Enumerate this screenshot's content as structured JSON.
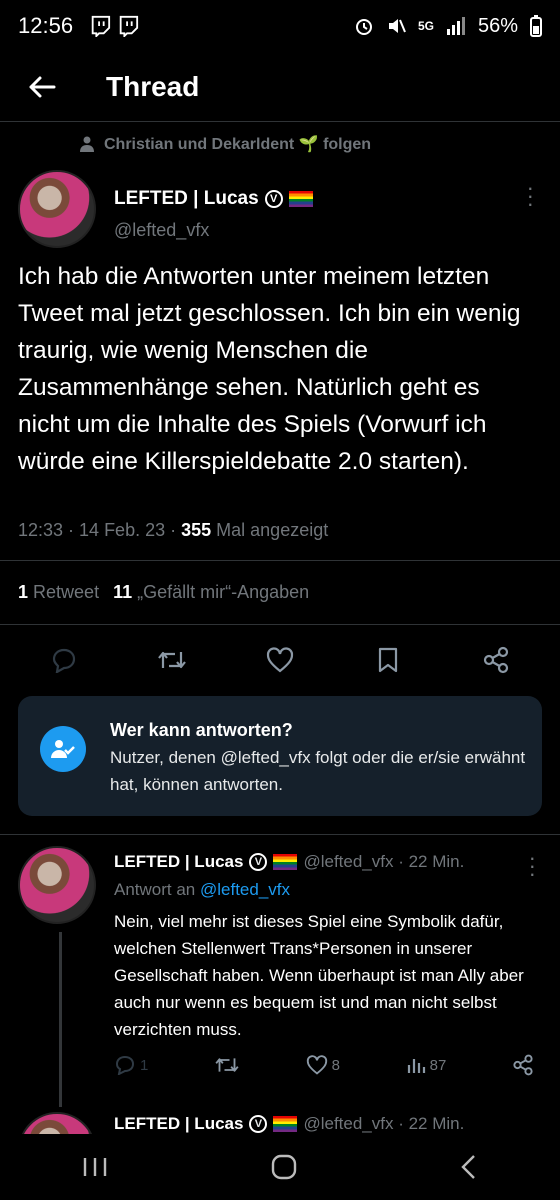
{
  "status_bar": {
    "time": "12:56",
    "left_icons": [
      "twitch-icon",
      "twitch-icon"
    ],
    "right_icons": [
      "alarm-icon",
      "mute-icon",
      "5g-icon",
      "signal-icon"
    ],
    "network": "5G",
    "battery": "56%"
  },
  "header": {
    "title": "Thread",
    "back_icon": "arrow-left-icon"
  },
  "social_context": {
    "text": "Christian und Dekarldent 🌱 folgen"
  },
  "tweet": {
    "author_name": "LEFTED | Lucas",
    "handle": "@lefted_vfx",
    "body": "Ich hab die Antworten unter meinem letzten Tweet mal jetzt geschlossen. Ich bin ein wenig traurig, wie wenig Menschen die Zusammenhänge sehen. Natürlich geht es nicht um die Inhalte des Spiels (Vorwurf ich würde eine Killerspieldebatte 2.0 starten).",
    "timestamp": "12:33 · 14 Feb. 23 · ",
    "views_count": "355",
    "views_label": " Mal angezeigt",
    "retweets_count": "1",
    "retweets_label": "Retweet",
    "likes_count": "11",
    "likes_label": "„Gefällt mir“-Angaben"
  },
  "reply_restriction": {
    "title": "Wer kann antworten?",
    "text": "Nutzer, denen @lefted_vfx folgt oder die er/sie erwähnt hat, können antworten."
  },
  "reply": {
    "author_name": "LEFTED | Lucas",
    "handle_time": "@lefted_vfx · 22 Min.",
    "reply_to_prefix": "Antwort an ",
    "reply_to_handle": "@lefted_vfx",
    "body": "Nein, viel mehr ist dieses Spiel eine Symbolik dafür, welchen Stellenwert Trans*Personen in unserer Gesellschaft haben. Wenn überhaupt ist man Ally aber auch nur wenn es bequem ist und man nicht selbst verzichten muss.",
    "replies": "1",
    "likes": "8",
    "views": "87"
  },
  "next_reply": {
    "author_name": "LEFTED | Lucas",
    "handle_time": "@lefted_vfx · 22 Min."
  },
  "colors": {
    "background": "#000000",
    "accent": "#1d9bf0",
    "muted": "#71767b",
    "card": "#15202b"
  }
}
